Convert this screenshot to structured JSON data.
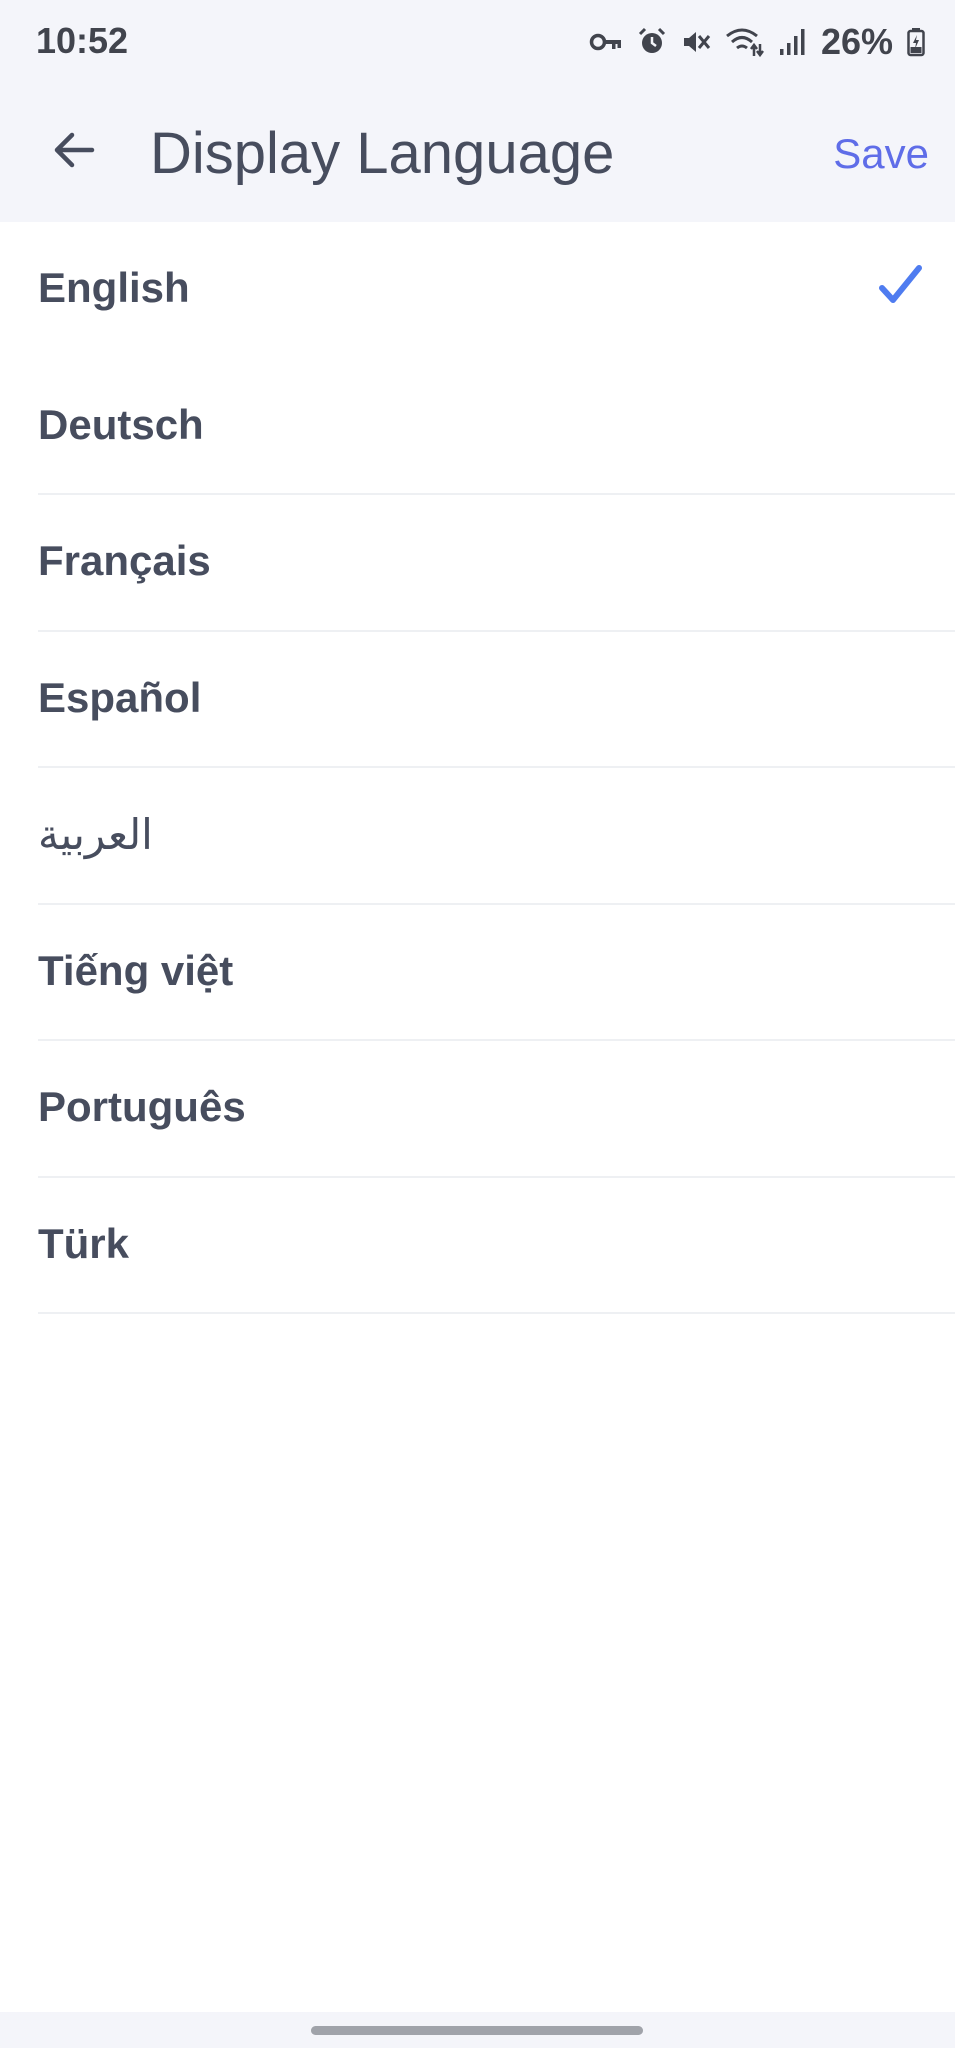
{
  "status_bar": {
    "time": "10:52",
    "battery": "26%",
    "icons": [
      "vpn-key-icon",
      "alarm-icon",
      "mute-icon",
      "wifi-icon",
      "signal-icon",
      "battery-icon"
    ]
  },
  "header": {
    "title": "Display Language",
    "save_label": "Save",
    "back_icon": "back-arrow-icon"
  },
  "languages": [
    {
      "label": "English",
      "selected": true
    },
    {
      "label": "Deutsch",
      "selected": false
    },
    {
      "label": "Français",
      "selected": false
    },
    {
      "label": "Español",
      "selected": false
    },
    {
      "label": "العربية",
      "selected": false
    },
    {
      "label": "Tiếng việt",
      "selected": false
    },
    {
      "label": "Português",
      "selected": false
    },
    {
      "label": "Türk",
      "selected": false
    }
  ],
  "colors": {
    "accent": "#5f6de8",
    "check": "#4f7cf0",
    "text": "#474d5e",
    "header_bg": "#f4f5fa"
  }
}
